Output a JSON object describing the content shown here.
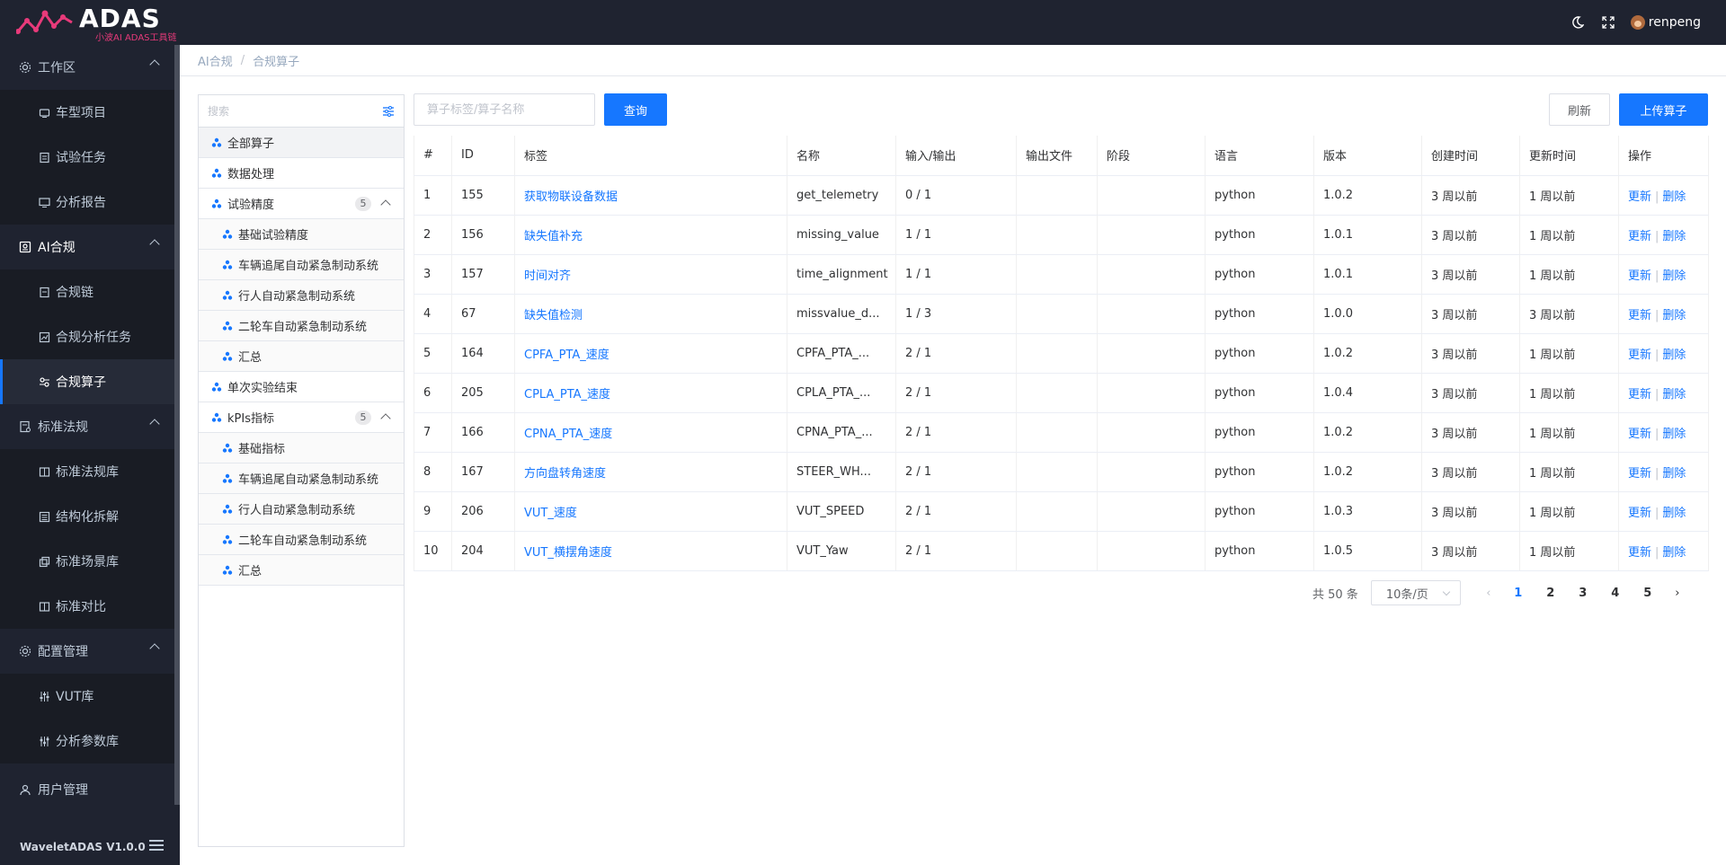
{
  "header": {
    "logo_text": "ADAS",
    "logo_subtitle": "小波AI ADAS工具链",
    "username": "renpeng",
    "icons": [
      "moon-icon",
      "fullscreen-icon"
    ]
  },
  "sidebar": {
    "groups": [
      {
        "label": "工作区",
        "icon": "gear-icon",
        "items": [
          {
            "label": "车型项目",
            "icon": "car-icon"
          },
          {
            "label": "试验任务",
            "icon": "task-icon"
          },
          {
            "label": "分析报告",
            "icon": "monitor-icon"
          }
        ]
      },
      {
        "label": "AI合规",
        "icon": "ai-icon",
        "items": [
          {
            "label": "合规链",
            "icon": "chain-icon"
          },
          {
            "label": "合规分析任务",
            "icon": "analysis-icon"
          },
          {
            "label": "合规算子",
            "icon": "operator-icon"
          }
        ]
      },
      {
        "label": "标准法规",
        "icon": "regulation-icon",
        "items": [
          {
            "label": "标准法规库",
            "icon": "library-icon"
          },
          {
            "label": "结构化拆解",
            "icon": "structure-icon"
          },
          {
            "label": "标准场景库",
            "icon": "scene-icon"
          },
          {
            "label": "标准对比",
            "icon": "compare-icon"
          }
        ]
      },
      {
        "label": "配置管理",
        "icon": "config-icon",
        "items": [
          {
            "label": "VUT库",
            "icon": "sliders-icon"
          },
          {
            "label": "分析参数库",
            "icon": "params-icon"
          }
        ]
      }
    ],
    "user_mgmt": "用户管理",
    "footer_version": "WaveletADAS  V1.0.0"
  },
  "breadcrumb": [
    "AI合规",
    "合规算子"
  ],
  "tree": {
    "search_placeholder": "搜索",
    "nodes": [
      {
        "label": "全部算子",
        "level": 1
      },
      {
        "label": "数据处理",
        "level": 1
      },
      {
        "label": "试验精度",
        "level": 1,
        "badge": "5"
      },
      {
        "label": "基础试验精度",
        "level": 2
      },
      {
        "label": "车辆追尾自动紧急制动系统",
        "level": 2
      },
      {
        "label": "行人自动紧急制动系统",
        "level": 2
      },
      {
        "label": "二轮车自动紧急制动系统",
        "level": 2
      },
      {
        "label": "汇总",
        "level": 2
      },
      {
        "label": "单次实验结束",
        "level": 1
      },
      {
        "label": "kPIs指标",
        "level": 1,
        "badge": "5"
      },
      {
        "label": "基础指标",
        "level": 2
      },
      {
        "label": "车辆追尾自动紧急制动系统",
        "level": 2
      },
      {
        "label": "行人自动紧急制动系统",
        "level": 2
      },
      {
        "label": "二轮车自动紧急制动系统",
        "level": 2
      },
      {
        "label": "汇总",
        "level": 2
      }
    ]
  },
  "toolbar": {
    "search_placeholder": "算子标签/算子名称",
    "query_label": "查询",
    "refresh_label": "刷新",
    "upload_label": "上传算子"
  },
  "table": {
    "columns": [
      "#",
      "ID",
      "标签",
      "名称",
      "输入/输出",
      "输出文件",
      "阶段",
      "语言",
      "版本",
      "创建时间",
      "更新时间",
      "操作"
    ],
    "rows": [
      [
        "1",
        "155",
        "获取物联设备数据",
        "get_telemetry",
        "0 / 1",
        "",
        "",
        "python",
        "1.0.2",
        "3 周以前",
        "1 周以前"
      ],
      [
        "2",
        "156",
        "缺失值补充",
        "missing_value",
        "1 / 1",
        "",
        "",
        "python",
        "1.0.1",
        "3 周以前",
        "1 周以前"
      ],
      [
        "3",
        "157",
        "时间对齐",
        "time_alignment",
        "1 / 1",
        "",
        "",
        "python",
        "1.0.1",
        "3 周以前",
        "1 周以前"
      ],
      [
        "4",
        "67",
        "缺失值检测",
        "missvalue_d...",
        "1 / 3",
        "",
        "",
        "python",
        "1.0.0",
        "3 周以前",
        "3 周以前"
      ],
      [
        "5",
        "164",
        "CPFA_PTA_速度",
        "CPFA_PTA_...",
        "2 / 1",
        "",
        "",
        "python",
        "1.0.2",
        "3 周以前",
        "1 周以前"
      ],
      [
        "6",
        "205",
        "CPLA_PTA_速度",
        "CPLA_PTA_...",
        "2 / 1",
        "",
        "",
        "python",
        "1.0.4",
        "3 周以前",
        "1 周以前"
      ],
      [
        "7",
        "166",
        "CPNA_PTA_速度",
        "CPNA_PTA_...",
        "2 / 1",
        "",
        "",
        "python",
        "1.0.2",
        "3 周以前",
        "1 周以前"
      ],
      [
        "8",
        "167",
        "方向盘转角速度",
        "STEER_WH...",
        "2 / 1",
        "",
        "",
        "python",
        "1.0.2",
        "3 周以前",
        "1 周以前"
      ],
      [
        "9",
        "206",
        "VUT_速度",
        "VUT_SPEED",
        "2 / 1",
        "",
        "",
        "python",
        "1.0.3",
        "3 周以前",
        "1 周以前"
      ],
      [
        "10",
        "204",
        "VUT_横摆角速度",
        "VUT_Yaw",
        "2 / 1",
        "",
        "",
        "python",
        "1.0.5",
        "3 周以前",
        "1 周以前"
      ]
    ],
    "op_update": "更新",
    "op_delete": "删除"
  },
  "pagination": {
    "total_text": "共 50 条",
    "page_size": "10条/页",
    "pages": [
      "1",
      "2",
      "3",
      "4",
      "5"
    ],
    "current": "1"
  },
  "colors": {
    "primary": "#1677ff",
    "sidebar_bg": "#1f2330",
    "logo_pink": "#e83a7a"
  }
}
